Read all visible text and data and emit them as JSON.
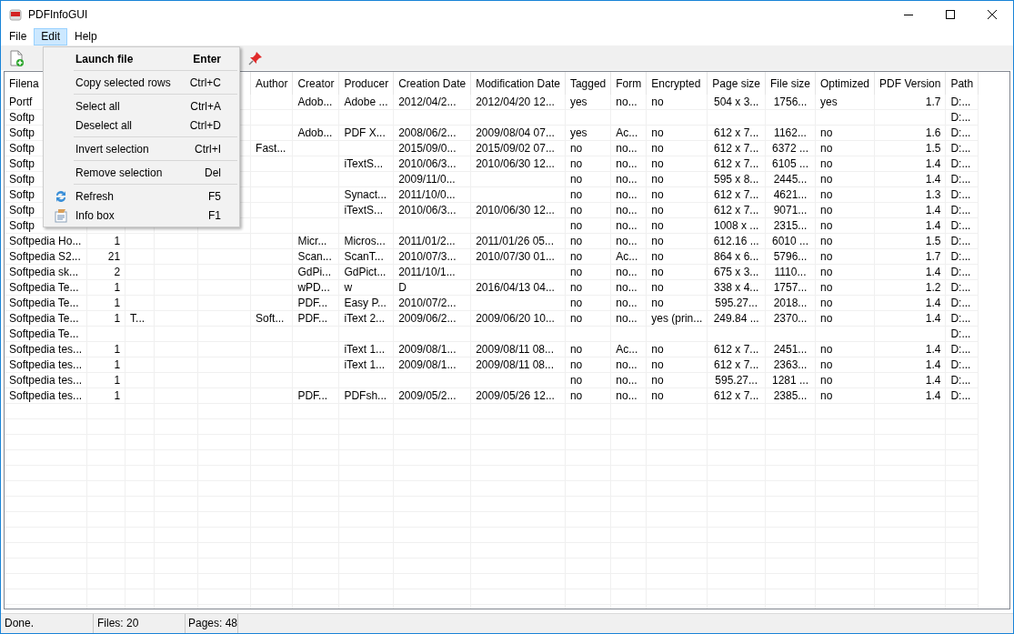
{
  "window": {
    "title": "PDFInfoGUI"
  },
  "menubar": [
    {
      "label": "File",
      "selected": false
    },
    {
      "label": "Edit",
      "selected": true
    },
    {
      "label": "Help",
      "selected": false
    }
  ],
  "edit_menu": {
    "items": [
      {
        "kind": "item",
        "label": "Launch file",
        "shortcut": "Enter",
        "default": true
      },
      {
        "kind": "separator"
      },
      {
        "kind": "item",
        "label": "Copy selected rows",
        "shortcut": "Ctrl+C",
        "default": false
      },
      {
        "kind": "separator"
      },
      {
        "kind": "item",
        "label": "Select all",
        "shortcut": "Ctrl+A",
        "default": false
      },
      {
        "kind": "item",
        "label": "Deselect all",
        "shortcut": "Ctrl+D",
        "default": false
      },
      {
        "kind": "separator"
      },
      {
        "kind": "item",
        "label": "Invert selection",
        "shortcut": "Ctrl+I",
        "default": false
      },
      {
        "kind": "separator"
      },
      {
        "kind": "item",
        "label": "Remove selection",
        "shortcut": "Del",
        "default": false
      },
      {
        "kind": "separator"
      },
      {
        "kind": "item",
        "label": "Refresh",
        "shortcut": "F5",
        "default": false
      },
      {
        "kind": "item",
        "label": "Info box",
        "shortcut": "F1",
        "default": false
      }
    ]
  },
  "table": {
    "columns": [
      "Filena",
      null,
      null,
      null,
      null,
      "Author",
      "Creator",
      "Producer",
      "Creation Date",
      "Modification Date",
      "Tagged",
      "Form",
      "Encrypted",
      "Page size",
      "File size",
      "Optimized",
      "PDF Version",
      "Path"
    ],
    "rows": [
      [
        "Portf",
        null,
        null,
        null,
        null,
        null,
        "Adob...",
        "Adobe ...",
        "2012/04/2...",
        "2012/04/20 12...",
        "yes",
        "no...",
        "no",
        "504 x 3...",
        "1756...",
        "yes",
        "1.7",
        "D:..."
      ],
      [
        "Softp",
        null,
        null,
        null,
        null,
        null,
        null,
        null,
        null,
        null,
        null,
        null,
        null,
        null,
        null,
        null,
        null,
        "D:..."
      ],
      [
        "Softp",
        null,
        null,
        null,
        null,
        null,
        "Adob...",
        "PDF X...",
        "2008/06/2...",
        "2009/08/04 07...",
        "yes",
        "Ac...",
        "no",
        "612 x 7...",
        "1162...",
        "no",
        "1.6",
        "D:..."
      ],
      [
        "Softp",
        null,
        null,
        null,
        null,
        "Fast...",
        null,
        null,
        "2015/09/0...",
        "2015/09/02 07...",
        "no",
        "no...",
        "no",
        "612 x 7...",
        "6372 ...",
        "no",
        "1.5",
        "D:..."
      ],
      [
        "Softp",
        null,
        null,
        null,
        null,
        null,
        null,
        "iTextS...",
        "2010/06/3...",
        "2010/06/30 12...",
        "no",
        "no...",
        "no",
        "612 x 7...",
        "6105 ...",
        "no",
        "1.4",
        "D:..."
      ],
      [
        "Softp",
        null,
        null,
        null,
        null,
        null,
        null,
        null,
        "2009/11/0...",
        null,
        "no",
        "no...",
        "no",
        "595 x 8...",
        "2445...",
        "no",
        "1.4",
        "D:..."
      ],
      [
        "Softp",
        null,
        null,
        null,
        null,
        null,
        null,
        "Synact...",
        "2011/10/0...",
        null,
        "no",
        "no...",
        "no",
        "612 x 7...",
        "4621...",
        "no",
        "1.3",
        "D:..."
      ],
      [
        "Softp",
        null,
        null,
        null,
        null,
        null,
        null,
        "iTextS...",
        "2010/06/3...",
        "2010/06/30 12...",
        "no",
        "no...",
        "no",
        "612 x 7...",
        "9071...",
        "no",
        "1.4",
        "D:..."
      ],
      [
        "Softp",
        null,
        null,
        null,
        null,
        null,
        null,
        null,
        null,
        null,
        "no",
        "no...",
        "no",
        "1008 x ...",
        "2315...",
        "no",
        "1.4",
        "D:..."
      ],
      [
        "Softpedia Ho...",
        "1",
        null,
        null,
        null,
        null,
        "Micr...",
        "Micros...",
        "2011/01/2...",
        "2011/01/26 05...",
        "no",
        "no...",
        "no",
        "612.16 ...",
        "6010 ...",
        "no",
        "1.5",
        "D:..."
      ],
      [
        "Softpedia S2...",
        "21",
        null,
        null,
        null,
        null,
        "Scan...",
        "ScanT...",
        "2010/07/3...",
        "2010/07/30 01...",
        "no",
        "Ac...",
        "no",
        "864 x 6...",
        "5796...",
        "no",
        "1.7",
        "D:..."
      ],
      [
        "Softpedia sk...",
        "2",
        null,
        null,
        null,
        null,
        "GdPi...",
        "GdPict...",
        "2011/10/1...",
        null,
        "no",
        "no...",
        "no",
        "675 x 3...",
        "1110...",
        "no",
        "1.4",
        "D:..."
      ],
      [
        "Softpedia Te...",
        "1",
        null,
        null,
        null,
        null,
        "wPD...",
        "w",
        "D",
        "2016/04/13 04...",
        "no",
        "no...",
        "no",
        "338 x 4...",
        "1757...",
        "no",
        "1.2",
        "D:..."
      ],
      [
        "Softpedia Te...",
        "1",
        null,
        null,
        null,
        null,
        "PDF...",
        "Easy P...",
        "2010/07/2...",
        null,
        "no",
        "no...",
        "no",
        "595.27...",
        "2018...",
        "no",
        "1.4",
        "D:..."
      ],
      [
        "Softpedia Te...",
        "1",
        "T...",
        null,
        null,
        "Soft...",
        "PDF...",
        "iText 2...",
        "2009/06/2...",
        "2009/06/20 10...",
        "no",
        "no...",
        "yes (prin...",
        "249.84 ...",
        "2370...",
        "no",
        "1.4",
        "D:..."
      ],
      [
        "Softpedia Te...",
        null,
        null,
        null,
        null,
        null,
        null,
        null,
        null,
        null,
        null,
        null,
        null,
        null,
        null,
        null,
        null,
        "D:..."
      ],
      [
        "Softpedia tes...",
        "1",
        null,
        null,
        null,
        null,
        null,
        "iText 1...",
        "2009/08/1...",
        "2009/08/11 08...",
        "no",
        "Ac...",
        "no",
        "612 x 7...",
        "2451...",
        "no",
        "1.4",
        "D:..."
      ],
      [
        "Softpedia tes...",
        "1",
        null,
        null,
        null,
        null,
        null,
        "iText 1...",
        "2009/08/1...",
        "2009/08/11 08...",
        "no",
        "no...",
        "no",
        "612 x 7...",
        "2363...",
        "no",
        "1.4",
        "D:..."
      ],
      [
        "Softpedia tes...",
        "1",
        null,
        null,
        null,
        null,
        null,
        null,
        null,
        null,
        "no",
        "no...",
        "no",
        "595.27...",
        "1281 ...",
        "no",
        "1.4",
        "D:..."
      ],
      [
        "Softpedia tes...",
        "1",
        null,
        null,
        null,
        null,
        "PDF...",
        "PDFsh...",
        "2009/05/2...",
        "2009/05/26 12...",
        "no",
        "no...",
        "no",
        "612 x 7...",
        "2385...",
        "no",
        "1.4",
        "D:..."
      ]
    ]
  },
  "status_bar": [
    "Done.",
    "Files: 20",
    "Pages: 48"
  ]
}
